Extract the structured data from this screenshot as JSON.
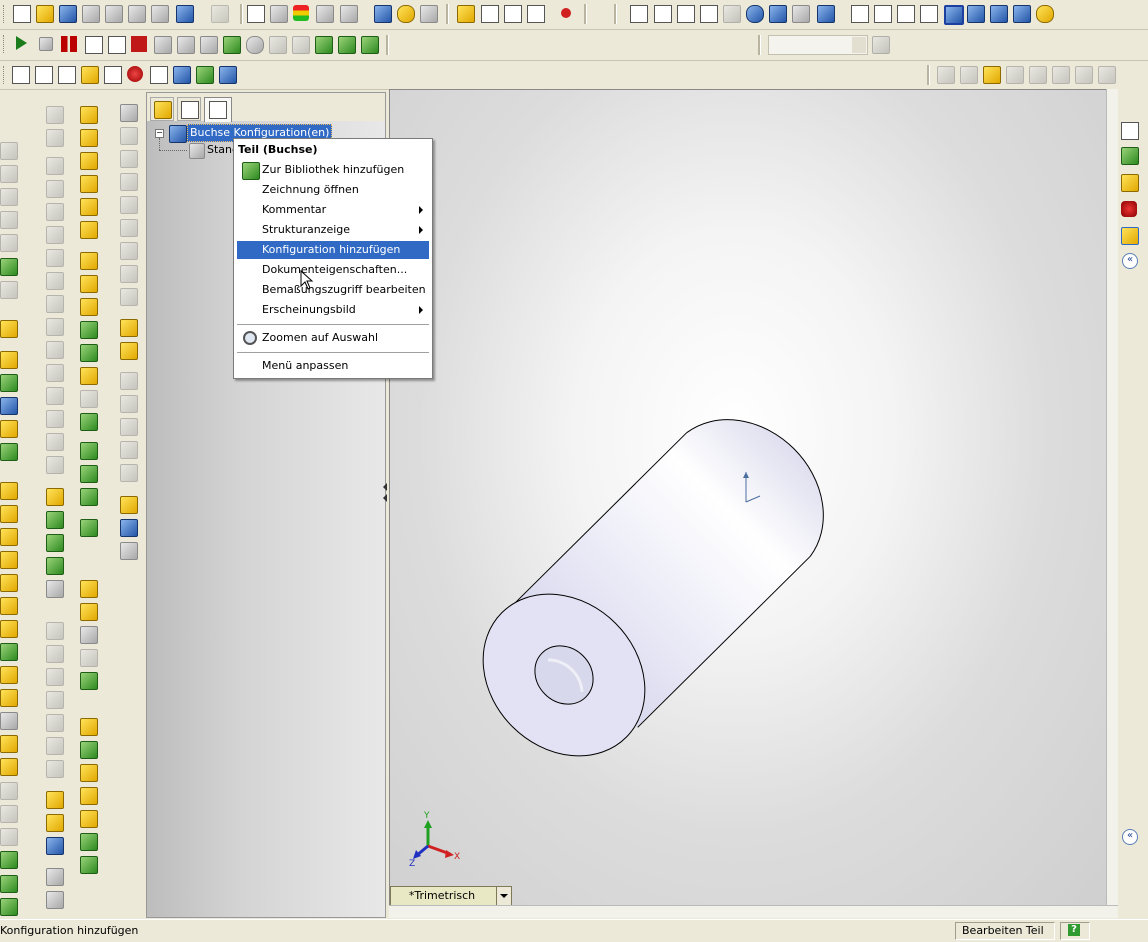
{
  "context_menu": {
    "title": "Teil (Buchse)",
    "items": [
      {
        "label": "Zur Bibliothek hinzufügen",
        "has_submenu": false
      },
      {
        "label": "Zeichnung öffnen",
        "has_submenu": false
      },
      {
        "label": "Kommentar",
        "has_submenu": true
      },
      {
        "label": "Strukturanzeige",
        "has_submenu": true
      },
      {
        "label": "Konfiguration hinzufügen",
        "has_submenu": false,
        "highlighted": true
      },
      {
        "label": "Dokumenteigenschaften...",
        "has_submenu": false
      },
      {
        "label": "Bemaßungszugriff bearbeiten",
        "has_submenu": false
      },
      {
        "label": "Erscheinungsbild",
        "has_submenu": true
      },
      {
        "label": "Zoomen auf Auswahl",
        "has_submenu": false
      },
      {
        "label": "Menü anpassen",
        "has_submenu": false
      }
    ]
  },
  "tree": {
    "root_label": "Buchse Konfiguration(en)",
    "child_label": "Stand"
  },
  "viewport": {
    "view_orientation": "*Trimetrisch",
    "triad": {
      "x": "X",
      "y": "Y",
      "z": "Z"
    }
  },
  "status_bar": {
    "message": "Konfiguration hinzufügen",
    "mode": "Bearbeiten Teil",
    "help": "?"
  },
  "colors": {
    "highlight": "#316ac5",
    "part_face": "#e6e6f5",
    "ui_face": "#ece9d8"
  }
}
